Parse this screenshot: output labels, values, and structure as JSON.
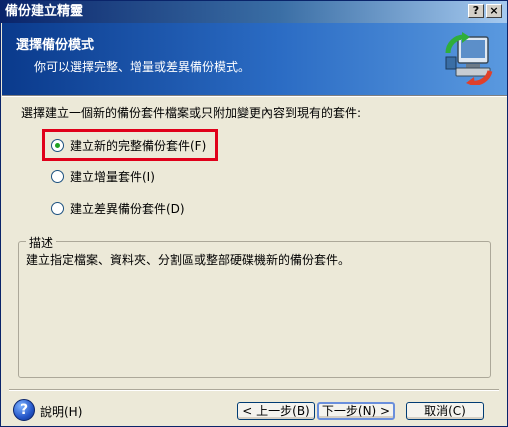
{
  "window": {
    "title": "備份建立精靈",
    "help_button": "?",
    "close_button": "×"
  },
  "header": {
    "title": "選擇備份模式",
    "subtitle": "你可以選擇完整、增量或差異備份模式。",
    "icon": "backup-computer-icon"
  },
  "prompt": "選擇建立一個新的備份套件檔案或只附加變更內容到現有的套件:",
  "options": [
    {
      "label": "建立新的完整備份套件(F)",
      "checked": true
    },
    {
      "label": "建立增量套件(I)",
      "checked": false
    },
    {
      "label": "建立差異備份套件(D)",
      "checked": false
    }
  ],
  "description": {
    "title": "描述",
    "text": "建立指定檔案、資料夾、分割區或整部硬碟機新的備份套件。"
  },
  "footer": {
    "help_label": "說明(H)",
    "back_label": "< 上一步(B)",
    "next_label": "下一步(N) >",
    "cancel_label": "取消(C)"
  },
  "colors": {
    "accent": "#0a246a",
    "highlight": "#e0001a",
    "radio_selected": "#21a121"
  }
}
